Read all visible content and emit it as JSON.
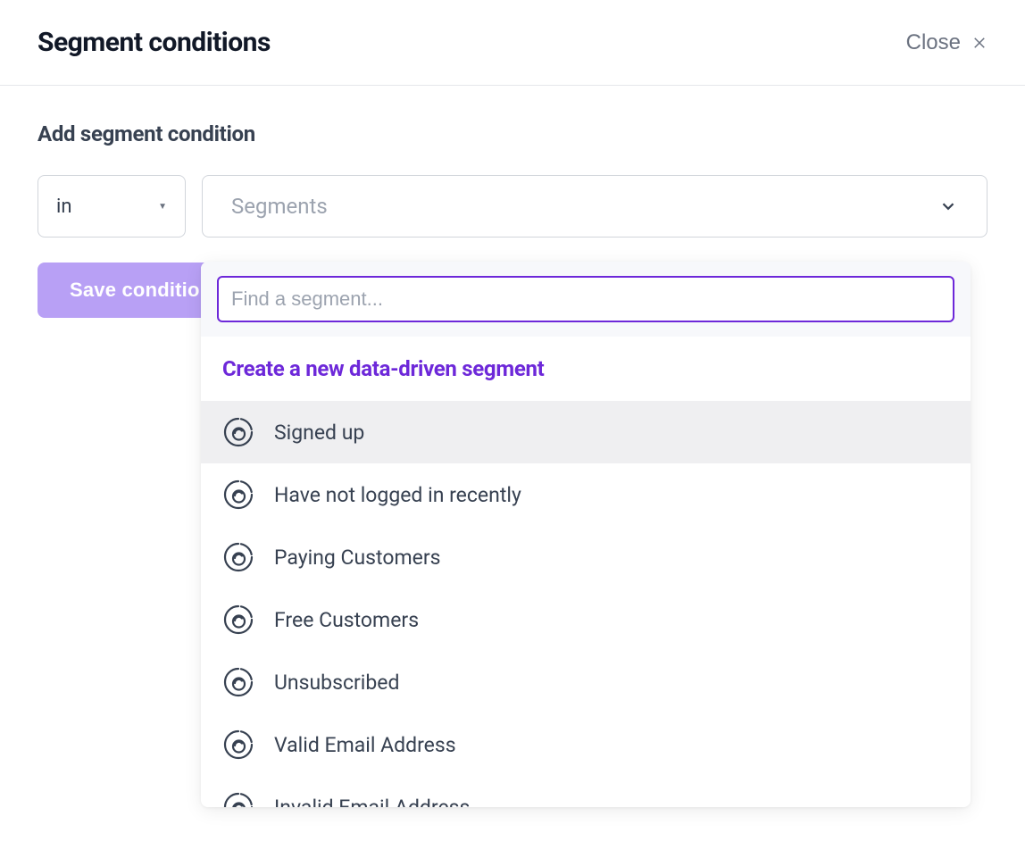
{
  "header": {
    "title": "Segment conditions",
    "close_label": "Close"
  },
  "section": {
    "title": "Add segment condition"
  },
  "condition_select": {
    "value": "in"
  },
  "segments_select": {
    "placeholder": "Segments"
  },
  "save_button": {
    "label": "Save condition"
  },
  "dropdown": {
    "search_placeholder": "Find a segment...",
    "create_link": "Create a new data-driven segment",
    "segments": [
      {
        "label": "Signed up",
        "highlighted": true
      },
      {
        "label": "Have not logged in recently",
        "highlighted": false
      },
      {
        "label": "Paying Customers",
        "highlighted": false
      },
      {
        "label": "Free Customers",
        "highlighted": false
      },
      {
        "label": "Unsubscribed",
        "highlighted": false
      },
      {
        "label": "Valid Email Address",
        "highlighted": false
      },
      {
        "label": "Invalid Email Address",
        "highlighted": false
      }
    ]
  }
}
